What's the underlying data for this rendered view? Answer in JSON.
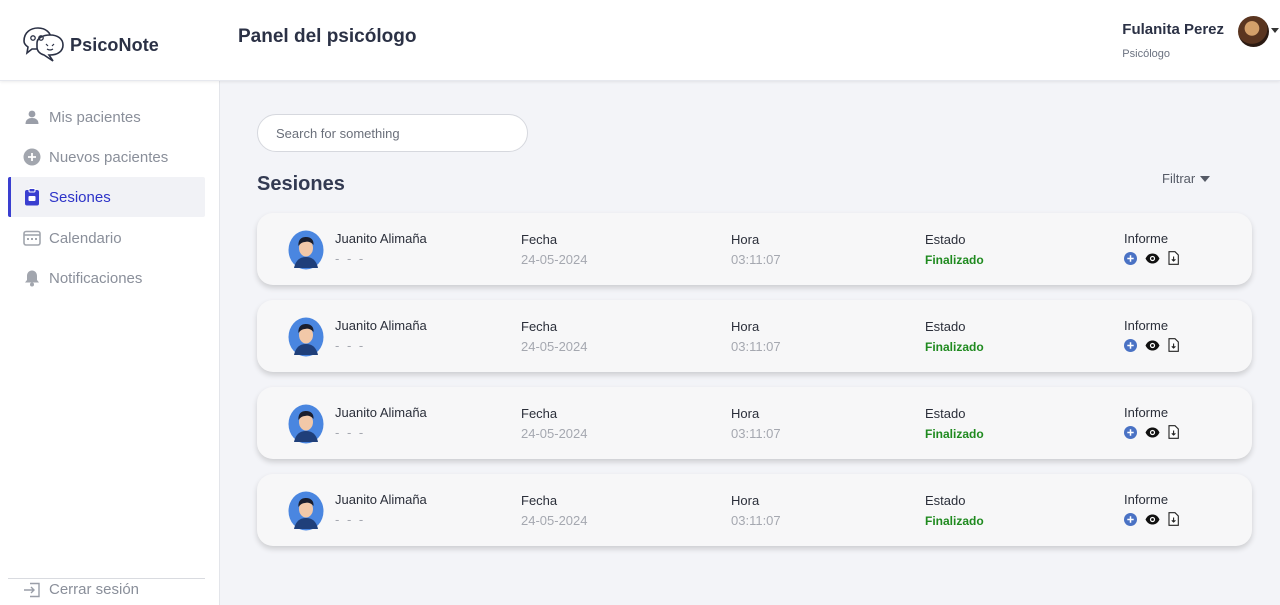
{
  "app": {
    "name": "PsicoNote"
  },
  "header": {
    "title": "Panel del psicólogo",
    "user_name": "Fulanita Perez",
    "user_role": "Psicólogo"
  },
  "sidebar": {
    "items": [
      {
        "label": "Mis pacientes",
        "icon": "person-icon"
      },
      {
        "label": "Nuevos pacientes",
        "icon": "plus-circle-icon"
      },
      {
        "label": "Sesiones",
        "icon": "clipboard-icon",
        "active": true
      },
      {
        "label": "Calendario",
        "icon": "calendar-icon"
      },
      {
        "label": "Notificaciones",
        "icon": "bell-icon"
      }
    ],
    "logout": "Cerrar sesión"
  },
  "search": {
    "placeholder": "Search for something"
  },
  "sessions": {
    "title": "Sesiones",
    "filter_label": "Filtrar",
    "rows": [
      {
        "patient": "Juanito Alimaña",
        "sub": "- - -",
        "fecha_label": "Fecha",
        "fecha": "24-05-2024",
        "hora_label": "Hora",
        "hora": "03:11:07",
        "estado_label": "Estado",
        "estado": "Finalizado",
        "informe_label": "Informe"
      },
      {
        "patient": "Juanito Alimaña",
        "sub": "- - -",
        "fecha_label": "Fecha",
        "fecha": "24-05-2024",
        "hora_label": "Hora",
        "hora": "03:11:07",
        "estado_label": "Estado",
        "estado": "Finalizado",
        "informe_label": "Informe"
      },
      {
        "patient": "Juanito Alimaña",
        "sub": "- - -",
        "fecha_label": "Fecha",
        "fecha": "24-05-2024",
        "hora_label": "Hora",
        "hora": "03:11:07",
        "estado_label": "Estado",
        "estado": "Finalizado",
        "informe_label": "Informe"
      },
      {
        "patient": "Juanito Alimaña",
        "sub": "- - -",
        "fecha_label": "Fecha",
        "fecha": "24-05-2024",
        "hora_label": "Hora",
        "hora": "03:11:07",
        "estado_label": "Estado",
        "estado": "Finalizado",
        "informe_label": "Informe"
      }
    ]
  },
  "colors": {
    "accent": "#3a3fd0",
    "status_ok": "#1f8a1f",
    "add_icon": "#4a72c4"
  }
}
